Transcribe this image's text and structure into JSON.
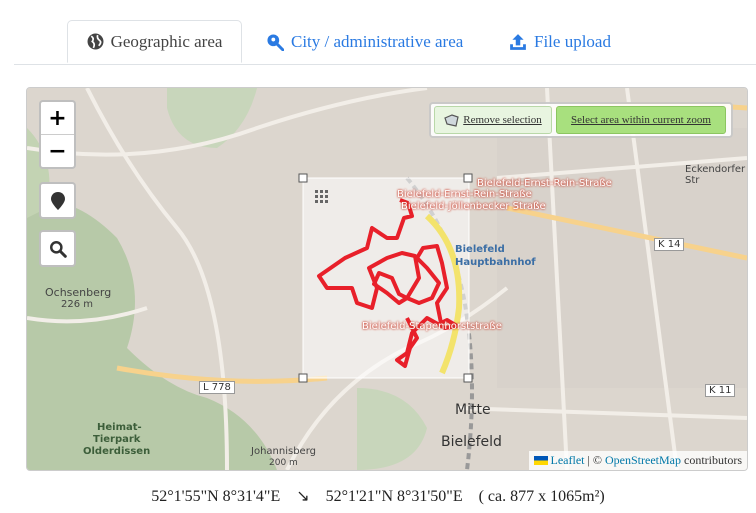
{
  "tabs": [
    {
      "label": "Geographic area",
      "icon": "globe-icon",
      "active": true
    },
    {
      "label": "City / administrative area",
      "icon": "search-location-icon",
      "active": false
    },
    {
      "label": "File upload",
      "icon": "upload-icon",
      "active": false
    }
  ],
  "map": {
    "zoom_in": "+",
    "zoom_out": "−",
    "selection_controls": {
      "remove_label": "Remove selection",
      "within_label": "Select area within current zoom"
    },
    "labels": {
      "ernst_rein_1": "Bielefeld-Ernst-Rein-Straße",
      "ernst_rein_2": "Bielefeld-Ernst-Rein-Straße",
      "jollenbecker": "Bielefeld-Jöllenbecker Straße",
      "hauptbahnhof": "Bielefeld\nHauptbahnhof",
      "stapenhorst": "Bielefeld-Stapenhorststraße",
      "ochsenberg": "Ochsenberg",
      "ochsenberg_height": "226 m",
      "eckendorfer": "Eckendorfer Str",
      "k14": "K 14",
      "k11": "K 11",
      "l778": "L 778",
      "mitte": "Mitte",
      "bielefeld": "Bielefeld",
      "heimat": "Heimat-",
      "tierpark": "Tierpark",
      "olderdissen": "Olderdissen",
      "johannisberg": "Johannisberg",
      "johannisberg_height": "200 m"
    },
    "attribution": {
      "leaflet": "Leaflet",
      "sep": "| ©",
      "osm": "OpenStreetMap",
      "contributors": "contributors"
    }
  },
  "coordinates": {
    "corner1": "52°1'55\"N 8°31'4\"E",
    "arrow": "↘",
    "corner2": "52°1'21\"N 8°31'50\"E",
    "area": "( ca. 877 x 1065m²)"
  },
  "colors": {
    "accent": "#2a7ae2",
    "route": "#e8202a",
    "selection_button": "#a8e07e"
  }
}
